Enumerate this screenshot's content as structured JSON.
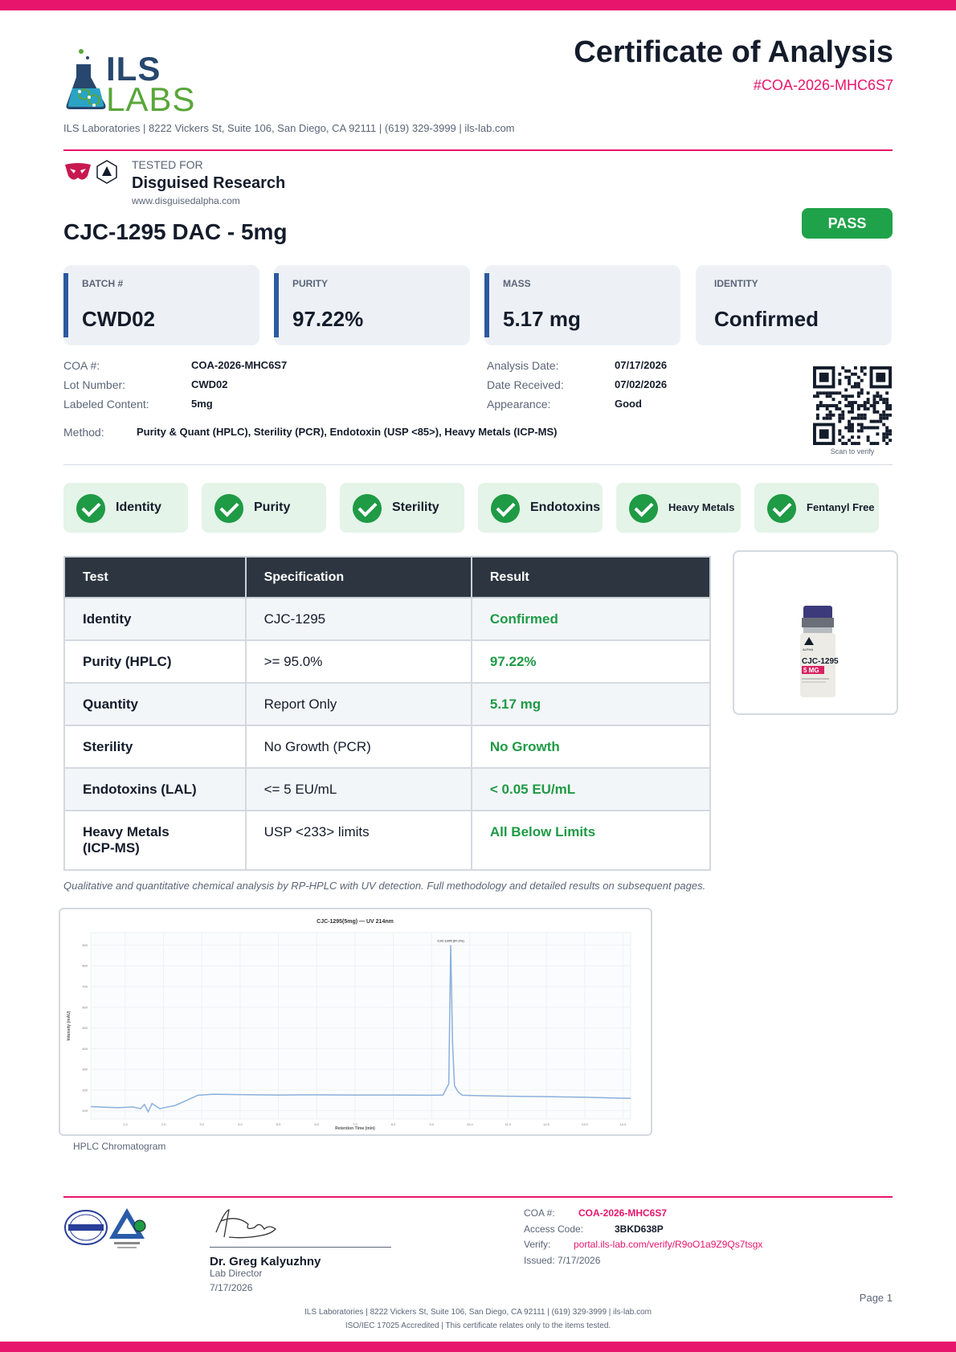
{
  "colors": {
    "accent": "#e8156c",
    "pass": "#1fa24a",
    "result_green": "#1f9a45",
    "header_dark": "#2d3640",
    "brand_blue": "#27476e",
    "brand_green": "#5aa63a"
  },
  "header": {
    "logo": {
      "icon": "flask-molecule-icon",
      "line1": "ILS",
      "line2": "LABS"
    },
    "title": "Certificate of Analysis",
    "coa_id": "#COA-2026-MHC6S7",
    "address_line": "ILS Laboratories  |  8222 Vickers St, Suite 106, San Diego, CA 92111  |  (619) 329-3999  |  ils-lab.com"
  },
  "client": {
    "icons": [
      "disguised-mask-logo-icon",
      "alpha-triangle-logo-icon"
    ],
    "tested_for_label": "TESTED FOR",
    "name": "Disguised Research",
    "url": "www.disguisedalpha.com"
  },
  "product": {
    "name": "CJC-1295 DAC - 5mg",
    "status": "PASS"
  },
  "summary_cards": [
    {
      "label": "BATCH #",
      "value": "CWD02"
    },
    {
      "label": "PURITY",
      "value": "97.22%"
    },
    {
      "label": "MASS",
      "value": "5.17 mg"
    },
    {
      "label": "IDENTITY",
      "value": "Confirmed"
    }
  ],
  "meta": {
    "left": [
      {
        "key": "COA #:",
        "value": "COA-2026-MHC6S7"
      },
      {
        "key": "Lot Number:",
        "value": "CWD02"
      },
      {
        "key": "Labeled Content:",
        "value": "5mg"
      }
    ],
    "right": [
      {
        "key": "Analysis Date:",
        "value": "07/17/2026"
      },
      {
        "key": "Date Received:",
        "value": "07/02/2026"
      },
      {
        "key": "Appearance:",
        "value": "Good"
      }
    ],
    "method_key": "Method:",
    "method_value": "Purity & Quant (HPLC), Sterility (PCR), Endotoxin (USP <85>), Heavy Metals (ICP-MS)",
    "qr_caption": "Scan to verify"
  },
  "badges": [
    "Identity",
    "Purity",
    "Sterility",
    "Endotoxins",
    "Heavy Metals",
    "Fentanyl Free"
  ],
  "results_table": {
    "headers": [
      "Test",
      "Specification",
      "Result"
    ],
    "rows": [
      {
        "test": "Identity",
        "spec": "CJC-1295",
        "result": "Confirmed"
      },
      {
        "test": "Purity (HPLC)",
        "spec": ">= 95.0%",
        "result": "97.22%"
      },
      {
        "test": "Quantity",
        "spec": "Report Only",
        "result": "5.17 mg"
      },
      {
        "test": "Sterility",
        "spec": "No Growth (PCR)",
        "result": "No Growth"
      },
      {
        "test": "Endotoxins (LAL)",
        "spec": "<= 5 EU/mL",
        "result": "< 0.05 EU/mL"
      },
      {
        "test": "Heavy Metals (ICP-MS)",
        "spec": "USP <233> limits",
        "result": "All Below Limits"
      }
    ]
  },
  "vial": {
    "brand": "ALPHA",
    "label": "CJC-1295",
    "dose": "5 MG"
  },
  "caption": "Qualitative and quantitative chemical analysis by RP-HPLC with UV detection. Full methodology and detailed results on subsequent pages.",
  "chromatogram": {
    "title": "CJC-1295(5mg) — UV 214nm",
    "xlabel": "Retention Time (min)",
    "ylabel": "Intensity (mAU)",
    "main_peak_label": "CJC-1295 (97.2%)",
    "x_ticks": [
      "1.0",
      "2.0",
      "3.0",
      "4.0",
      "5.0",
      "6.0",
      "7.0",
      "8.0",
      "9.0",
      "10.0",
      "11.0",
      "12.0",
      "13.0",
      "14.0"
    ],
    "y_ticks": [
      "100",
      "200",
      "300",
      "400",
      "500",
      "600",
      "700",
      "800",
      "900"
    ],
    "caption": "HPLC Chromatogram"
  },
  "chart_data": {
    "type": "line",
    "title": "CJC-1295(5mg) — UV 214nm",
    "xlabel": "Retention Time (min)",
    "ylabel": "Intensity (mAU)",
    "xlim": [
      0.1,
      14.2
    ],
    "ylim": [
      60,
      960
    ],
    "x": [
      0.1,
      0.8,
      1.2,
      1.4,
      1.5,
      1.6,
      1.7,
      1.9,
      2.1,
      2.3,
      2.6,
      2.9,
      3.3,
      4,
      5,
      6,
      7,
      8,
      9,
      9.3,
      9.45,
      9.5,
      9.55,
      9.6,
      9.7,
      9.8,
      10.2,
      11,
      12,
      13,
      14.2
    ],
    "series": [
      {
        "values": [
          120,
          115,
          118,
          110,
          130,
          95,
          135,
          110,
          118,
          125,
          150,
          175,
          180,
          178,
          176,
          177,
          176,
          176,
          175,
          176,
          230,
          900,
          420,
          220,
          190,
          175,
          173,
          170,
          168,
          165,
          160
        ]
      }
    ]
  },
  "footer": {
    "accreditation_icons": [
      "ilac-mra-logo-icon",
      "pjla-testing-logo-icon"
    ],
    "signature_icon": "signature-icon",
    "signer_name": "Dr. Greg Kalyuzhny",
    "signer_role": "Lab Director",
    "signer_date": "7/17/2026",
    "coa_key": "COA #:",
    "coa_value": "COA-2026-MHC6S7",
    "access_key": "Access Code:",
    "access_value": "3BKD638P",
    "verify_key": "Verify:",
    "verify_value": "portal.ils-lab.com/verify/R9oO1a9Z9Qs7tsgx",
    "issued": "Issued: 7/17/2026",
    "page": "Page 1",
    "line1": "ILS Laboratories  |  8222 Vickers St, Suite 106, San Diego, CA 92111  |  (619) 329-3999  |  ils-lab.com",
    "line2": "ISO/IEC 17025 Accredited  |  This certificate relates only to the items tested."
  }
}
